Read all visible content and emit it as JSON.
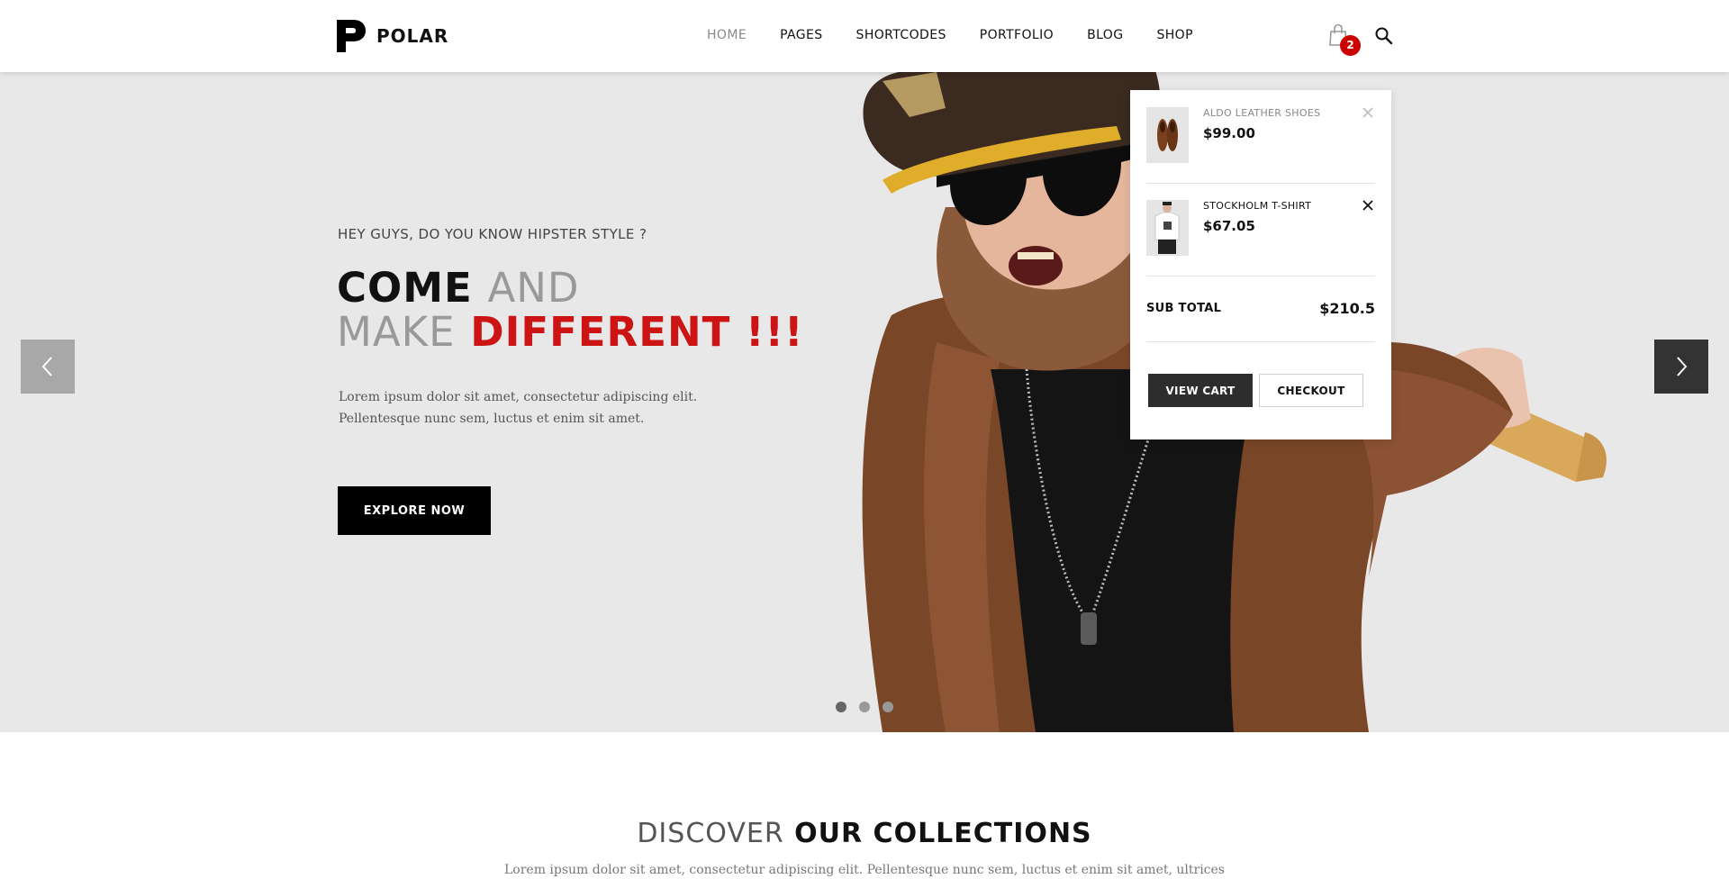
{
  "header": {
    "brand": "POLAR",
    "nav": [
      {
        "label": "HOME",
        "active": true
      },
      {
        "label": "PAGES",
        "active": false
      },
      {
        "label": "SHORTCODES",
        "active": false
      },
      {
        "label": "PORTFOLIO",
        "active": false
      },
      {
        "label": "BLOG",
        "active": false
      },
      {
        "label": "SHOP",
        "active": false
      }
    ],
    "cart_icon": "shopping-bag-icon",
    "cart_count": "2",
    "search_icon": "search-icon"
  },
  "hero": {
    "subtitle": "HEY GUYS, DO YOU KNOW HIPSTER STYLE ?",
    "title_line1_a": "COME",
    "title_line1_b": "AND",
    "title_line2_a": "MAKE",
    "title_line2_b": "DIFFERENT !!!",
    "text_line1": "Lorem ipsum dolor sit amet, consectetur  adipiscing elit.",
    "text_line2": "Pellentesque nunc sem, luctus et enim sit amet.",
    "button_label": "EXPLORE NOW",
    "prev_icon": "chevron-left-icon",
    "next_icon": "chevron-right-icon",
    "slides": 3,
    "active_slide": 1,
    "accent_color": "#cc1414"
  },
  "cart": {
    "items": [
      {
        "name": "ALDO LEATHER SHOES",
        "price": "$99.00",
        "thumb_icon": "shoes-thumbnail"
      },
      {
        "name": "STOCKHOLM T-SHIRT",
        "price": "$67.05",
        "thumb_icon": "tshirt-thumbnail"
      }
    ],
    "subtotal_label": "SUB TOTAL",
    "subtotal_value": "$210.5",
    "view_cart_label": "VIEW CART",
    "checkout_label": "CHECKOUT"
  },
  "collections": {
    "title_light": "DISCOVER",
    "title_bold": "OUR COLLECTIONS",
    "text": "Lorem ipsum dolor sit amet, consectetur adipiscing elit. Pellentesque nunc sem, luctus et enim sit amet, ultrices"
  }
}
